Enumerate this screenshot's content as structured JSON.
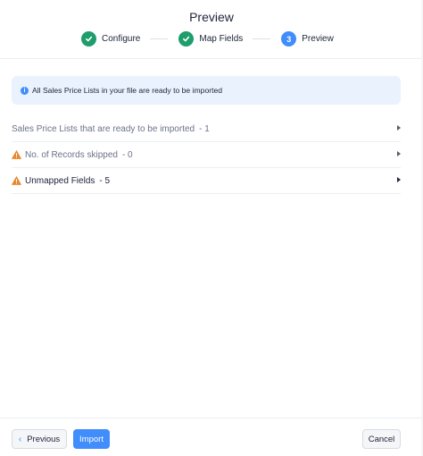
{
  "header": {
    "title": "Preview",
    "steps": [
      {
        "label": "Configure",
        "state": "done"
      },
      {
        "label": "Map Fields",
        "state": "done"
      },
      {
        "number": "3",
        "label": "Preview",
        "state": "active"
      }
    ]
  },
  "banner": {
    "icon": "info-icon",
    "text": "All Sales Price Lists in your file are ready to be imported"
  },
  "rows": [
    {
      "label": "Sales Price Lists that are ready to be imported",
      "count": "- 1",
      "icon": null
    },
    {
      "label": "No. of Records skipped",
      "count": "- 0",
      "icon": "warning-icon"
    },
    {
      "label": "Unmapped Fields",
      "count": "- 5",
      "icon": "warning-icon"
    }
  ],
  "footer": {
    "previous_label": "Previous",
    "import_label": "Import",
    "cancel_label": "Cancel"
  },
  "colors": {
    "accent": "#408dfb",
    "success": "#1f9d6c",
    "warning": "#e8892d",
    "banner_bg": "#eaf2fd"
  }
}
